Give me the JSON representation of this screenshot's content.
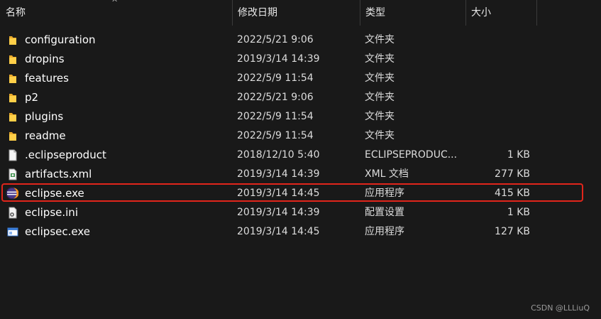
{
  "columns": {
    "name": "名称",
    "date": "修改日期",
    "type": "类型",
    "size": "大小"
  },
  "files": [
    {
      "name": "configuration",
      "date": "2022/5/21 9:06",
      "type": "文件夹",
      "size": "",
      "icon": "folder-icon"
    },
    {
      "name": "dropins",
      "date": "2019/3/14 14:39",
      "type": "文件夹",
      "size": "",
      "icon": "folder-icon"
    },
    {
      "name": "features",
      "date": "2022/5/9 11:54",
      "type": "文件夹",
      "size": "",
      "icon": "folder-icon"
    },
    {
      "name": "p2",
      "date": "2022/5/21 9:06",
      "type": "文件夹",
      "size": "",
      "icon": "folder-icon"
    },
    {
      "name": "plugins",
      "date": "2022/5/9 11:54",
      "type": "文件夹",
      "size": "",
      "icon": "folder-icon"
    },
    {
      "name": "readme",
      "date": "2022/5/9 11:54",
      "type": "文件夹",
      "size": "",
      "icon": "folder-icon"
    },
    {
      "name": ".eclipseproduct",
      "date": "2018/12/10 5:40",
      "type": "ECLIPSEPRODUC...",
      "size": "1 KB",
      "icon": "blank-file-icon"
    },
    {
      "name": "artifacts.xml",
      "date": "2019/3/14 14:39",
      "type": "XML 文档",
      "size": "277 KB",
      "icon": "xml-file-icon"
    },
    {
      "name": "eclipse.exe",
      "date": "2019/3/14 14:45",
      "type": "应用程序",
      "size": "415 KB",
      "icon": "eclipse-icon"
    },
    {
      "name": "eclipse.ini",
      "date": "2019/3/14 14:39",
      "type": "配置设置",
      "size": "1 KB",
      "icon": "settings-file-icon"
    },
    {
      "name": "eclipsec.exe",
      "date": "2019/3/14 14:45",
      "type": "应用程序",
      "size": "127 KB",
      "icon": "app-window-icon"
    }
  ],
  "highlight_color": "#e1251b",
  "watermark": "CSDN @LLLiuQ"
}
